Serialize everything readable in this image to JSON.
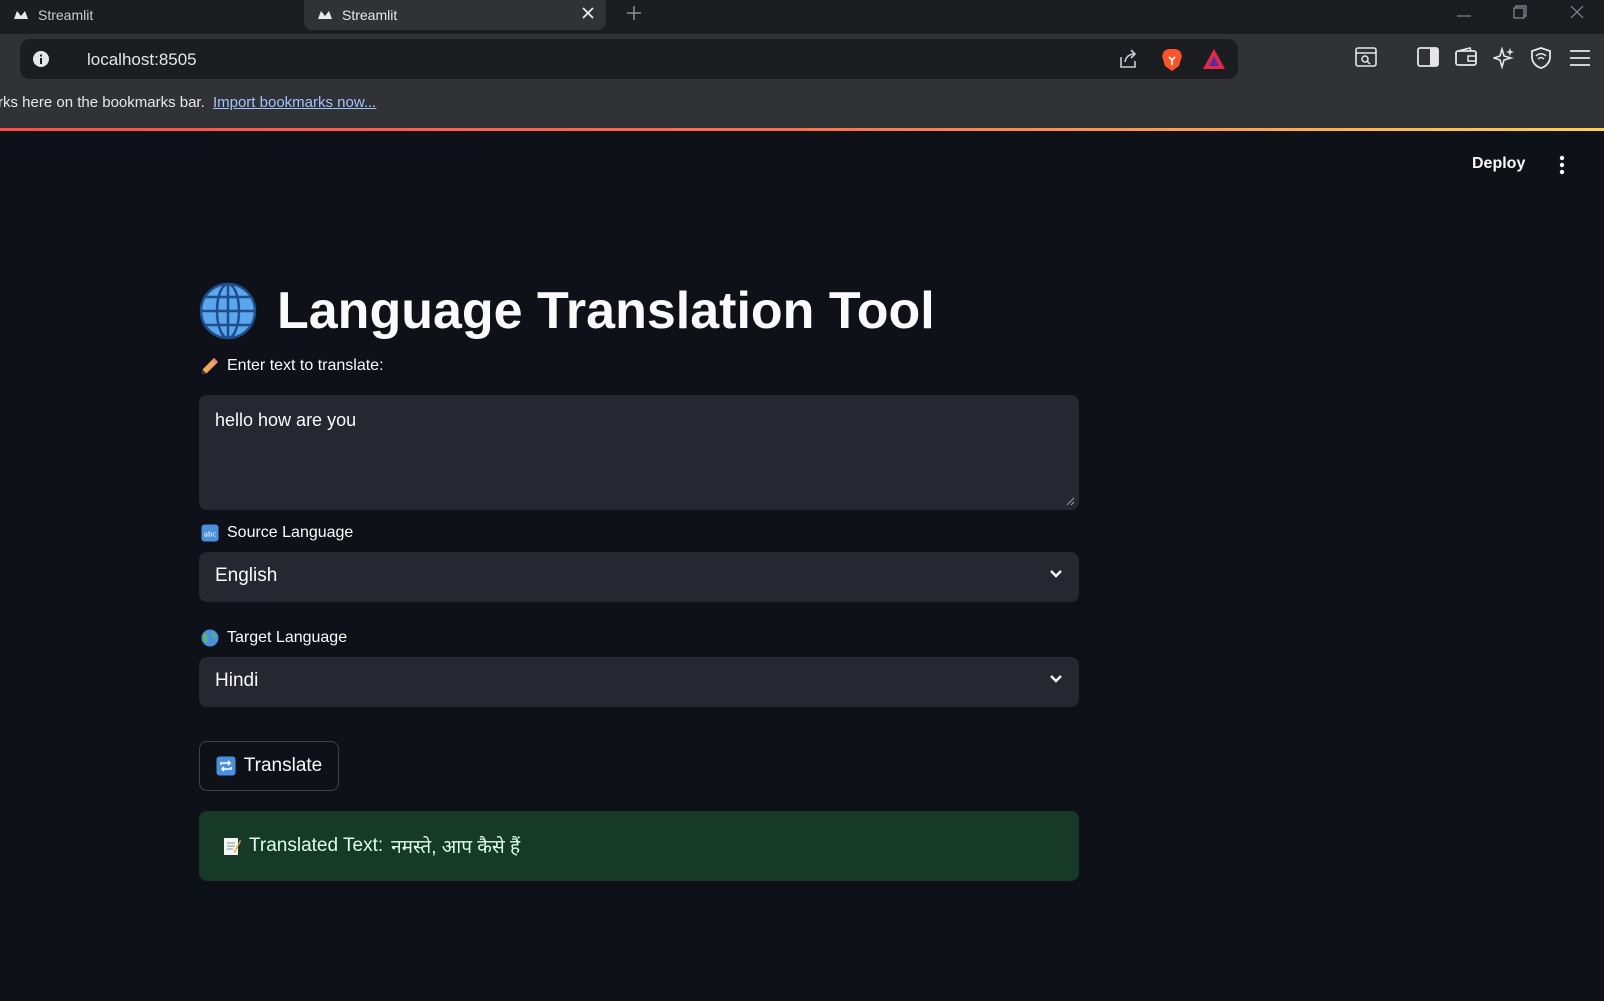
{
  "browser": {
    "tabs": [
      {
        "title": "Streamlit",
        "active": false
      },
      {
        "title": "Streamlit",
        "active": true
      }
    ],
    "url": "localhost:8505",
    "bookmarks_bar": {
      "message": "rks here on the bookmarks bar.",
      "import_link": "Import bookmarks now..."
    },
    "accent_gradient": [
      "#ff4b4b",
      "#ffd24b"
    ]
  },
  "app": {
    "header": {
      "deploy_label": "Deploy"
    },
    "title": "Language Translation Tool",
    "input": {
      "label": "Enter text to translate:",
      "value": "hello how are you"
    },
    "source": {
      "label": "Source Language",
      "selected": "English"
    },
    "target": {
      "label": "Target Language",
      "selected": "Hindi"
    },
    "translate_button": {
      "label": "Translate"
    },
    "result": {
      "prefix": "Translated Text:",
      "text": "नमस्ते, आप कैसे हैं"
    },
    "colors": {
      "background": "#0e1117",
      "widget_bg": "#262730",
      "success_bg": "#173928",
      "success_text": "#dffde9"
    }
  }
}
